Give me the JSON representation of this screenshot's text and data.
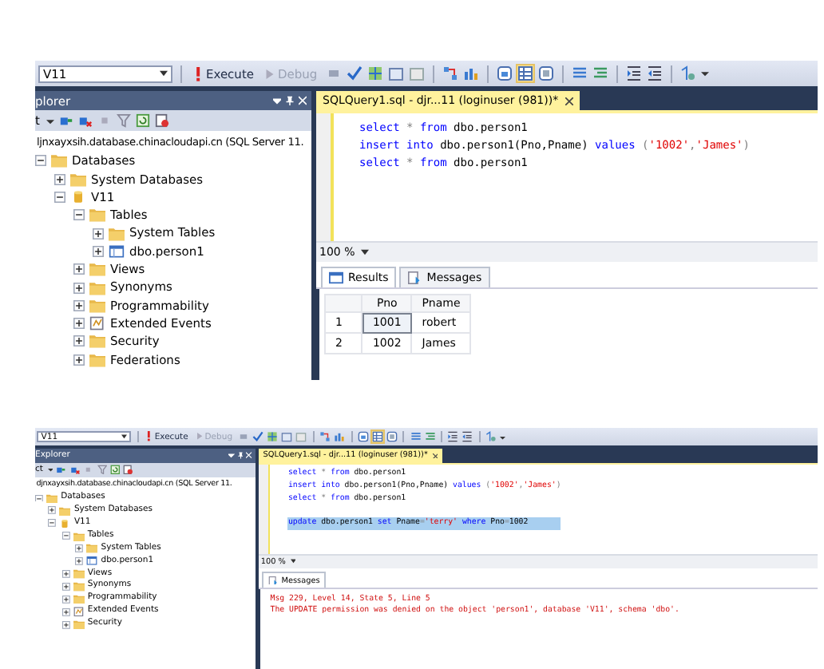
{
  "screenshots": [
    {
      "toolbar": {
        "database": "V11",
        "buttons": [
          {
            "label": "Execute",
            "disabled": false
          },
          {
            "label": "Debug",
            "disabled": true
          }
        ]
      },
      "explorer": {
        "title": "plorer",
        "connect": "t",
        "server": "ljnxayxsih.database.chinacloudapi.cn (SQL Server 11.",
        "tree": [
          {
            "label": "Databases",
            "kind": "folder",
            "expanded": true,
            "children": [
              {
                "label": "System Databases",
                "kind": "folder",
                "expanded": false
              },
              {
                "label": "V11",
                "kind": "database",
                "expanded": true,
                "children": [
                  {
                    "label": "Tables",
                    "kind": "folder",
                    "expanded": true,
                    "children": [
                      {
                        "label": "System Tables",
                        "kind": "folder",
                        "expanded": false
                      },
                      {
                        "label": "dbo.person1",
                        "kind": "table",
                        "expanded": false
                      }
                    ]
                  },
                  {
                    "label": "Views",
                    "kind": "folder",
                    "expanded": false
                  },
                  {
                    "label": "Synonyms",
                    "kind": "folder",
                    "expanded": false
                  },
                  {
                    "label": "Programmability",
                    "kind": "folder",
                    "expanded": false
                  },
                  {
                    "label": "Extended Events",
                    "kind": "events",
                    "expanded": false
                  },
                  {
                    "label": "Security",
                    "kind": "folder",
                    "expanded": false
                  },
                  {
                    "label": "Federations",
                    "kind": "folder",
                    "expanded": false
                  }
                ]
              }
            ]
          }
        ]
      },
      "editor": {
        "tab": "SQLQuery1.sql - djr...11 (loginuser (981))*",
        "code": [
          {
            "selected": false,
            "blank_before": false,
            "tokens": [
              {
                "kind": "keyword",
                "text": "select"
              },
              {
                "kind": "operator",
                "text": " * "
              },
              {
                "kind": "keyword",
                "text": "from"
              },
              {
                "kind": "plain",
                "text": " dbo.person1"
              }
            ]
          },
          {
            "selected": false,
            "blank_before": false,
            "tokens": [
              {
                "kind": "keyword",
                "text": "insert into"
              },
              {
                "kind": "plain",
                "text": " dbo.person1(Pno,Pname) "
              },
              {
                "kind": "keyword",
                "text": "values"
              },
              {
                "kind": "operator",
                "text": " ("
              },
              {
                "kind": "string",
                "text": "'1002'"
              },
              {
                "kind": "operator",
                "text": ","
              },
              {
                "kind": "string",
                "text": "'James'"
              },
              {
                "kind": "operator",
                "text": ")"
              }
            ]
          },
          {
            "selected": false,
            "blank_before": false,
            "tokens": [
              {
                "kind": "keyword",
                "text": "select"
              },
              {
                "kind": "operator",
                "text": " * "
              },
              {
                "kind": "keyword",
                "text": "from"
              },
              {
                "kind": "plain",
                "text": " dbo.person1"
              }
            ]
          }
        ],
        "zoom": "100 %",
        "result_tabs": [
          {
            "label": "Results",
            "kind": "grid",
            "selected": true
          },
          {
            "label": "Messages",
            "kind": "messages",
            "selected": false
          }
        ],
        "grid": {
          "columns": [
            "Pno",
            "Pname"
          ],
          "rows": [
            {
              "number": "1",
              "cells": [
                {
                  "text": "1001",
                  "selected": true
                },
                {
                  "text": "robert",
                  "selected": false
                }
              ]
            },
            {
              "number": "2",
              "cells": [
                {
                  "text": "1002",
                  "selected": false
                },
                {
                  "text": "James",
                  "selected": false
                }
              ]
            }
          ]
        }
      }
    },
    {
      "toolbar": {
        "database": "V11",
        "buttons": [
          {
            "label": "Execute",
            "disabled": false
          },
          {
            "label": "Debug",
            "disabled": true
          }
        ]
      },
      "explorer": {
        "title": "Explorer",
        "connect": "ct",
        "server": "djnxayxsih.database.chinacloudapi.cn (SQL Server 11.",
        "tree": [
          {
            "label": "Databases",
            "kind": "folder",
            "expanded": true,
            "children": [
              {
                "label": "System Databases",
                "kind": "folder",
                "expanded": false
              },
              {
                "label": "V11",
                "kind": "database",
                "expanded": true,
                "children": [
                  {
                    "label": "Tables",
                    "kind": "folder",
                    "expanded": true,
                    "children": [
                      {
                        "label": "System Tables",
                        "kind": "folder",
                        "expanded": false
                      },
                      {
                        "label": "dbo.person1",
                        "kind": "table",
                        "expanded": false
                      }
                    ]
                  },
                  {
                    "label": "Views",
                    "kind": "folder",
                    "expanded": false
                  },
                  {
                    "label": "Synonyms",
                    "kind": "folder",
                    "expanded": false
                  },
                  {
                    "label": "Programmability",
                    "kind": "folder",
                    "expanded": false
                  },
                  {
                    "label": "Extended Events",
                    "kind": "events",
                    "expanded": false
                  },
                  {
                    "label": "Security",
                    "kind": "folder",
                    "expanded": false
                  }
                ]
              }
            ]
          }
        ]
      },
      "editor": {
        "tab": "SQLQuery1.sql - djr...11 (loginuser (981))*",
        "code": [
          {
            "selected": false,
            "blank_before": false,
            "tokens": [
              {
                "kind": "keyword",
                "text": "select"
              },
              {
                "kind": "operator",
                "text": " * "
              },
              {
                "kind": "keyword",
                "text": "from"
              },
              {
                "kind": "plain",
                "text": " dbo.person1"
              }
            ]
          },
          {
            "selected": false,
            "blank_before": false,
            "tokens": [
              {
                "kind": "keyword",
                "text": "insert into"
              },
              {
                "kind": "plain",
                "text": " dbo.person1(Pno,Pname) "
              },
              {
                "kind": "keyword",
                "text": "values"
              },
              {
                "kind": "operator",
                "text": " ("
              },
              {
                "kind": "string",
                "text": "'1002'"
              },
              {
                "kind": "operator",
                "text": ","
              },
              {
                "kind": "string",
                "text": "'James'"
              },
              {
                "kind": "operator",
                "text": ")"
              }
            ]
          },
          {
            "selected": false,
            "blank_before": false,
            "tokens": [
              {
                "kind": "keyword",
                "text": "select"
              },
              {
                "kind": "operator",
                "text": " * "
              },
              {
                "kind": "keyword",
                "text": "from"
              },
              {
                "kind": "plain",
                "text": " dbo.person1"
              }
            ]
          },
          {
            "selected": true,
            "blank_before": true,
            "tokens": [
              {
                "kind": "keyword",
                "text": "update"
              },
              {
                "kind": "plain",
                "text": " dbo.person1 "
              },
              {
                "kind": "keyword",
                "text": "set"
              },
              {
                "kind": "plain",
                "text": " Pname"
              },
              {
                "kind": "operator",
                "text": "="
              },
              {
                "kind": "string",
                "text": "'terry'"
              },
              {
                "kind": "keyword",
                "text": " where"
              },
              {
                "kind": "plain",
                "text": " Pno"
              },
              {
                "kind": "operator",
                "text": "="
              },
              {
                "kind": "plain",
                "text": "1002"
              }
            ]
          }
        ],
        "zoom": "100 %",
        "result_tabs": [
          {
            "label": "Messages",
            "kind": "messages",
            "selected": true
          }
        ],
        "messages": [
          "Msg 229, Level 14, State 5, Line 5",
          "The UPDATE permission was denied on the object 'person1', database 'V11', schema 'dbo'."
        ]
      }
    }
  ]
}
